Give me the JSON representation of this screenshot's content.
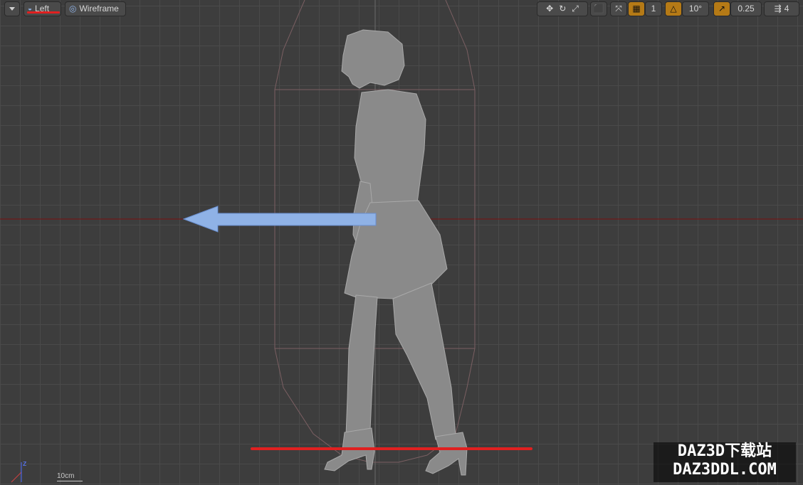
{
  "toolbar": {
    "view_mode": "Left",
    "render_mode": "Wireframe",
    "grid_size": "1",
    "rotation_snap": "10°",
    "scale_snap": "0.25",
    "camera_speed": "4"
  },
  "viewport": {
    "scale_label": "10cm",
    "axis_label": "z"
  },
  "watermark": {
    "line1": "DAZ3D下载站",
    "line2": "DAZ3DDL.COM"
  },
  "colors": {
    "background": "#3d3d3d",
    "grid": "#4a4a4a",
    "axis_line": "#7a1010",
    "arrow": "#8fb2e6",
    "annotation_red": "#e02020",
    "snap_orange": "#b57a16"
  }
}
